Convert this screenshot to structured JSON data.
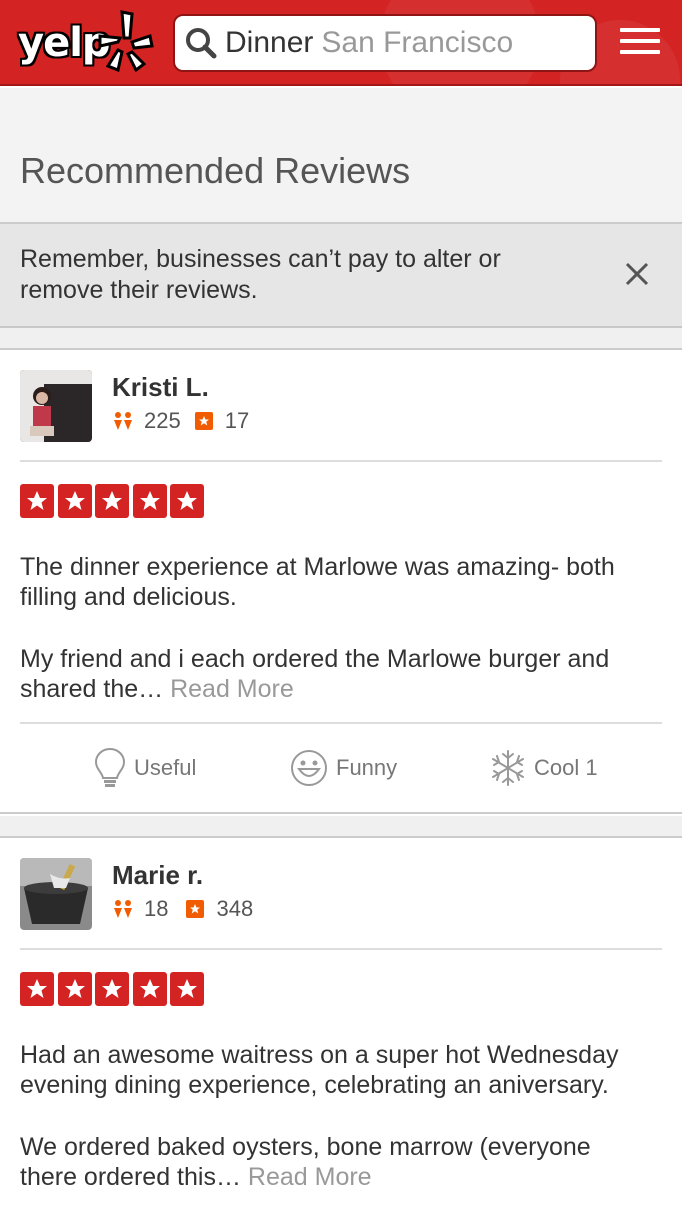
{
  "header": {
    "logo_text": "yelp",
    "search_term": "Dinner",
    "search_location": "San Francisco",
    "brand_color": "#d32323"
  },
  "section": {
    "title": "Recommended Reviews"
  },
  "notice": {
    "text": "Remember, businesses can’t pay to alter or remove their reviews."
  },
  "reviews": [
    {
      "user_name": "Kristi L.",
      "friends": "225",
      "review_count": "17",
      "rating": 5,
      "paragraphs": [
        "The dinner experience at Marlowe was amazing- both filling and delicious.",
        "My friend and i each ordered the Marlowe burger and shared the…"
      ],
      "read_more": "Read More",
      "votes": {
        "useful": "Useful",
        "funny": "Funny",
        "cool": "Cool 1"
      }
    },
    {
      "user_name": "Marie r.",
      "friends": "18",
      "review_count": "348",
      "rating": 5,
      "paragraphs": [
        "Had an awesome waitress on a super hot Wednesday evening dining experience, celebrating an aniversary.",
        "We ordered baked oysters, bone marrow (everyone there ordered this…"
      ],
      "read_more": "Read More"
    }
  ]
}
